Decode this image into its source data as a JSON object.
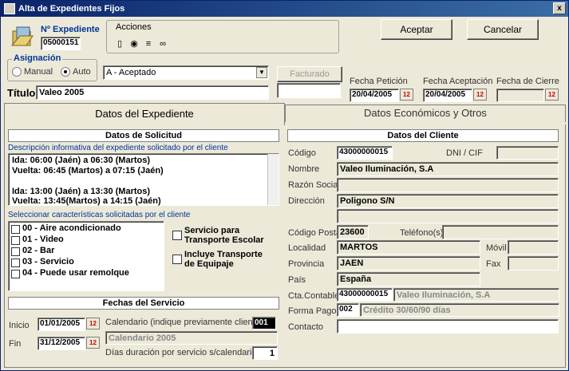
{
  "window": {
    "title": "Alta de Expedientes Fijos",
    "close": "x"
  },
  "expediente": {
    "label": "Nº Expediente",
    "value": "05000151"
  },
  "acciones": {
    "label": "Acciones"
  },
  "buttons": {
    "aceptar": "Aceptar",
    "cancelar": "Cancelar",
    "facturado": "Facturado"
  },
  "asignacion": {
    "label": "Asignación",
    "manual": "Manual",
    "auto": "Auto"
  },
  "estado": {
    "value": "A - Aceptado"
  },
  "titulo": {
    "label": "Título",
    "value": "Valeo 2005"
  },
  "fechas": {
    "peticion_label": "Fecha Petición",
    "peticion": "20/04/2005",
    "aceptacion_label": "Fecha Aceptación",
    "aceptacion": "20/04/2005",
    "cierre_label": "Fecha de Cierre",
    "cierre": ""
  },
  "tabs": {
    "expediente": "Datos del Expediente",
    "economicos": "Datos Económicos y Otros"
  },
  "solicitud": {
    "header": "Datos de Solicitud",
    "desc_label": "Descripción informativa del expediente solicitado por el cliente",
    "desc_lines": [
      "Ida: 06:00 (Jaén) a 06:30 (Martos)",
      "Vuelta: 06:45 (Martos) a 07:15 (Jaén)",
      "",
      "Ida: 13:00 (Jaén) a 13:30 (Martos)",
      "Vuelta: 13:45(Martos) a 14:15 (Jaén)"
    ],
    "caract_label": "Seleccionar características solicitadas por el cliente",
    "caracteristicas": [
      "00 - Aire acondicionado",
      "01 - Video",
      "02 - Bar",
      "03 - Servicio",
      "04 - Puede usar remolque"
    ],
    "servicio_escolar": "Servicio para Transporte Escolar",
    "transporte_equipaje": "Incluye Transporte de Equipaje"
  },
  "servicio": {
    "header": "Fechas del Servicio",
    "inicio_label": "Inicio",
    "inicio": "01/01/2005",
    "fin_label": "Fin",
    "fin": "31/12/2005",
    "calendario_label": "Calendario (indique previamente cliente)",
    "calendario_code": "001",
    "calendario_name": "Calendario 2005",
    "dias_label": "Días duración por servicio s/calendario",
    "dias": "1"
  },
  "cliente": {
    "header": "Datos del Cliente",
    "codigo_label": "Código",
    "codigo": "43000000015",
    "dni_label": "DNI / CIF",
    "dni": "",
    "nombre_label": "Nombre",
    "nombre": "Valeo Iluminación, S.A",
    "razon_label": "Razón Social",
    "razon": "",
    "direccion_label": "Dirección",
    "direccion": "Poligono S/N",
    "direccion2": "",
    "cp_label": "Código Postal",
    "cp": "23600",
    "telefono_label": "Teléfono(s)",
    "telefono": "",
    "localidad_label": "Localidad",
    "localidad": "MARTOS",
    "movil_label": "Móvil",
    "movil": "",
    "provincia_label": "Provincia",
    "provincia": "JAEN",
    "fax_label": "Fax",
    "fax": "",
    "pais_label": "País",
    "pais": "España",
    "cta_label": "Cta.Contable",
    "cta": "43000000015",
    "cta_name": "Valeo Iluminación, S.A",
    "forma_label": "Forma Pago",
    "forma_code": "002",
    "forma_name": "Crédito 30/60/90 días",
    "contacto_label": "Contacto",
    "contacto": ""
  }
}
